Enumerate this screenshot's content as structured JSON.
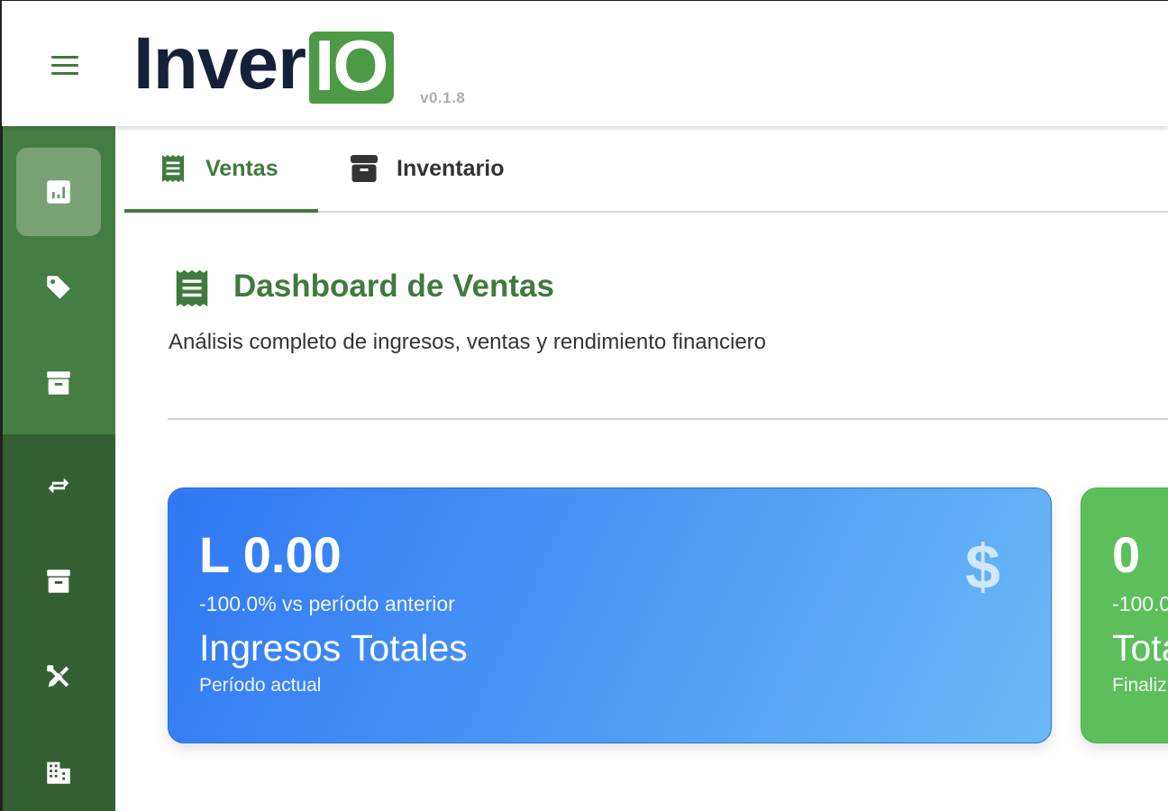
{
  "app": {
    "logo_text": "Inver",
    "logo_box": "IO",
    "version": "v0.1.8"
  },
  "sidebar": {
    "items": [
      {
        "icon": "dashboard-chart-icon",
        "active": true
      },
      {
        "icon": "tag-icon",
        "active": false
      },
      {
        "icon": "archive-box-icon",
        "active": false
      },
      {
        "icon": "swap-arrows-icon",
        "active": false
      },
      {
        "icon": "archive-box-icon",
        "active": false
      },
      {
        "icon": "tools-icon",
        "active": false
      },
      {
        "icon": "building-icon",
        "active": false
      }
    ]
  },
  "tabs": [
    {
      "label": "Ventas",
      "icon": "receipt-icon",
      "active": true
    },
    {
      "label": "Inventario",
      "icon": "archive-box-icon",
      "active": false
    }
  ],
  "dashboard": {
    "title": "Dashboard de Ventas",
    "subtitle": "Análisis completo de ingresos, ventas y rendimiento financiero"
  },
  "cards": [
    {
      "value": "L 0.00",
      "delta": "-100.0% vs período anterior",
      "label": "Ingresos Totales",
      "note": "Período actual",
      "icon": "$"
    },
    {
      "value": "0",
      "delta": "-100.0",
      "label": "Tota",
      "note": "Finaliz"
    }
  ],
  "colors": {
    "primary_green": "#3f7a3e",
    "sidebar_top": "#447e42",
    "sidebar_bottom": "#335f32",
    "logo_navy": "#152039",
    "card_blue": "#2f78f5",
    "card_green": "#5cbf5c"
  }
}
